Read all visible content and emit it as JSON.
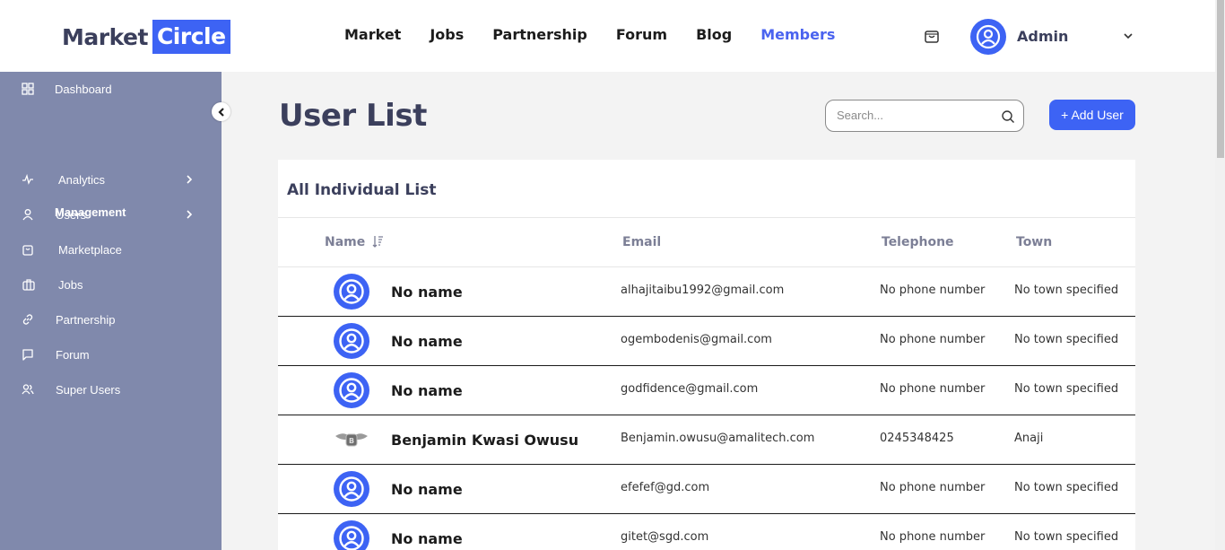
{
  "brand": {
    "word1": "Market",
    "word2": "Circle",
    "accent": "#3d63f4"
  },
  "nav": {
    "items": [
      "Market",
      "Jobs",
      "Partnership",
      "Forum",
      "Blog",
      "Members"
    ],
    "active": "Members"
  },
  "header": {
    "cart_icon": "shopping-bag-icon",
    "user_name": "Admin"
  },
  "sidebar": {
    "section": "Management",
    "items": [
      {
        "label": "Dashboard",
        "icon": "grid-icon"
      },
      {
        "label": "Analytics",
        "icon": "activity-icon",
        "has_arrow": true
      },
      {
        "label": "Users",
        "icon": "user-icon",
        "has_arrow": true
      },
      {
        "label": "Marketplace",
        "icon": "bag-icon"
      },
      {
        "label": "Jobs",
        "icon": "briefcase-icon"
      },
      {
        "label": "Partnership",
        "icon": "link-icon"
      },
      {
        "label": "Forum",
        "icon": "message-icon"
      },
      {
        "label": "Super Users",
        "icon": "users-icon"
      }
    ],
    "bg": "#8089ac"
  },
  "main": {
    "title": "User List",
    "search_placeholder": "Search...",
    "add_button": "+ Add User",
    "card_title": "All Individual List",
    "columns": [
      "Name",
      "Email",
      "Telephone",
      "Town"
    ],
    "rows": [
      {
        "name": "No name",
        "email": "alhajitaibu1992@gmail.com",
        "telephone": "No phone number",
        "town": "No town specified",
        "avatar": "default"
      },
      {
        "name": "No name",
        "email": "ogembodenis@gmail.com",
        "telephone": "No phone number",
        "town": "No town specified",
        "avatar": "default"
      },
      {
        "name": "No name",
        "email": "godfidence@gmail.com",
        "telephone": "No phone number",
        "town": "No town specified",
        "avatar": "default"
      },
      {
        "name": "Benjamin Kwasi Owusu",
        "email": "Benjamin.owusu@amalitech.com",
        "telephone": "0245348425",
        "town": "Anaji",
        "avatar": "photo"
      },
      {
        "name": "No name",
        "email": "efefef@gd.com",
        "telephone": "No phone number",
        "town": "No town specified",
        "avatar": "default"
      },
      {
        "name": "No name",
        "email": "gitet@sgd.com",
        "telephone": "No phone number",
        "town": "No town specified",
        "avatar": "default"
      }
    ]
  }
}
